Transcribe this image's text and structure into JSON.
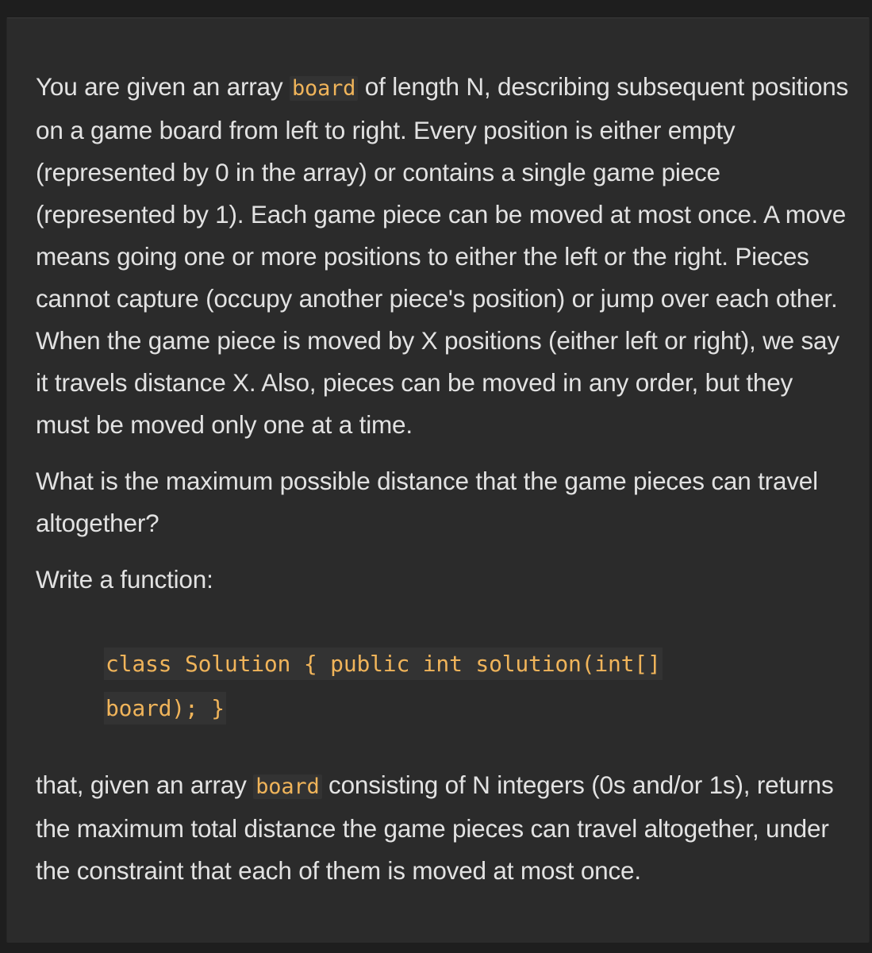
{
  "para1": {
    "before": "You are given an array ",
    "code": "board",
    "after": " of length N, describing subsequent positions on a game board from left to right. Every position is either empty (represented by 0 in the array) or contains a single game piece (represented by 1). Each game piece can be moved at most once. A move means going one or more positions to either the left or the right. Pieces cannot capture (occupy another piece's position) or jump over each other. When the game piece is moved by X positions (either left or right), we say it travels distance X. Also, pieces can be moved in any order, but they must be moved only one at a time."
  },
  "para2": "What is the maximum possible distance that the game pieces can travel altogether?",
  "para3": "Write a function:",
  "code_block": "class Solution { public int solution(int[] board); }",
  "para4": {
    "before": "that, given an array ",
    "code": "board",
    "after": " consisting of N integers (0s and/or 1s), returns the maximum total distance the game pieces can travel altogether, under the constraint that each of them is moved at most once."
  }
}
